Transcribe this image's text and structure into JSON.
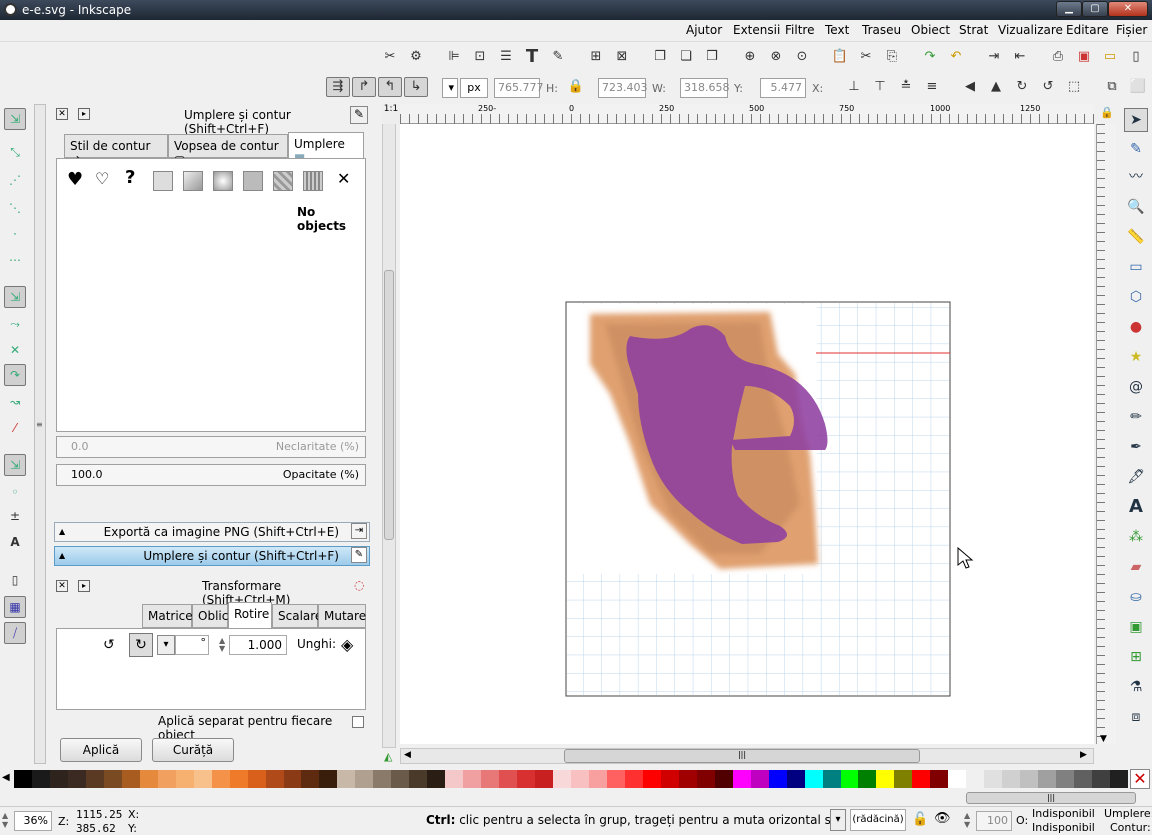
{
  "window": {
    "title": "e-e.svg - Inkscape",
    "btn_min": "▁",
    "btn_max": "▢",
    "btn_close": "✕"
  },
  "menu": [
    "Ajutor",
    "Extensii",
    "Filtre",
    "Text",
    "Traseu",
    "Obiect",
    "Strat",
    "Vizualizare",
    "Editare",
    "Fișier"
  ],
  "toolbar2": {
    "unit": "px",
    "x_label": "X:",
    "x_value": "765.777",
    "h_label": "H:",
    "h_value": "723.403",
    "w_label": "W:",
    "w_value": "318.658",
    "y_label": "Y:",
    "y_value": "5.477"
  },
  "ruler": {
    "labels": [
      "250-",
      "0",
      "250",
      "500",
      "750",
      "1000",
      "1250"
    ]
  },
  "dock": {
    "fill_stroke_title": "Umplere și contur (Shift+Ctrl+F)",
    "tabs": [
      "Stil de contur",
      "Vopsea de contur",
      "Umplere"
    ],
    "no_objects": "No objects",
    "blur_value": "0.0",
    "blur_label": "Neclaritate (%)",
    "opacity_value": "100.0",
    "opacity_label": "Opacitate (%)",
    "export_png": "Exportă ca imagine PNG (Shift+Ctrl+E)",
    "fill_stroke_expander": "Umplere și contur (Shift+Ctrl+F)",
    "transform_title": "Transformare (Shift+Ctrl+M)",
    "transform_tabs": [
      "Matrice",
      "Oblic",
      "Rotire",
      "Scalare",
      "Mutare"
    ],
    "rotate_value": "1.000",
    "degree": "°",
    "angle_label": "Unghi:",
    "apply_separately": "Aplică separat pentru fiecare obiect",
    "apply": "Aplică",
    "clear": "Curăță"
  },
  "palette_colors": [
    "#000000",
    "#1a1a1a",
    "#2e241d",
    "#3a2a21",
    "#5a3a22",
    "#7a4a22",
    "#a85c20",
    "#e58a3c",
    "#f2a060",
    "#f6b070",
    "#f8c08a",
    "#f4924a",
    "#ee7a2a",
    "#d8601a",
    "#b04a18",
    "#8a3a14",
    "#5e2a10",
    "#3a1e0c",
    "#c8b8a8",
    "#b0a090",
    "#8a7a6a",
    "#6a5a4a",
    "#4a3a2a",
    "#2a1e14",
    "#f4c8c8",
    "#f0a0a0",
    "#e87878",
    "#e05050",
    "#d83030",
    "#c82020",
    "#f8d8d8",
    "#f8c0c0",
    "#f8a0a0",
    "#ff6060",
    "#ff3030",
    "#ff0000",
    "#d00000",
    "#a00000",
    "#800000",
    "#500000",
    "#ff00ff",
    "#c000c0",
    "#0000ff",
    "#000080",
    "#00ffff",
    "#008080",
    "#00ff00",
    "#008000",
    "#ffff00",
    "#808000",
    "#ff0000",
    "#800000",
    "#ffffff",
    "#f0f0f0",
    "#e0e0e0",
    "#d0d0d0",
    "#c0c0c0",
    "#a0a0a0",
    "#808080",
    "#606060",
    "#404040",
    "#202020"
  ],
  "status": {
    "zoom": "36%",
    "z_label": "Z:",
    "coord_x": "1115.25",
    "coord_y": "385.62",
    "x_label": "X:",
    "y_label": "Y:",
    "hint_bold": "Ctrl:",
    "hint": " clic pentru a selecta în grup, trageți pentru a muta orizontal sau vertical",
    "layer": "(rădăcină)",
    "opacity": "100",
    "o_label": "O:",
    "fill_label": "Indisponibil",
    "stroke_label": "Indisponibil",
    "fill_right": "Umplere:",
    "stroke_right": "Contur:"
  }
}
